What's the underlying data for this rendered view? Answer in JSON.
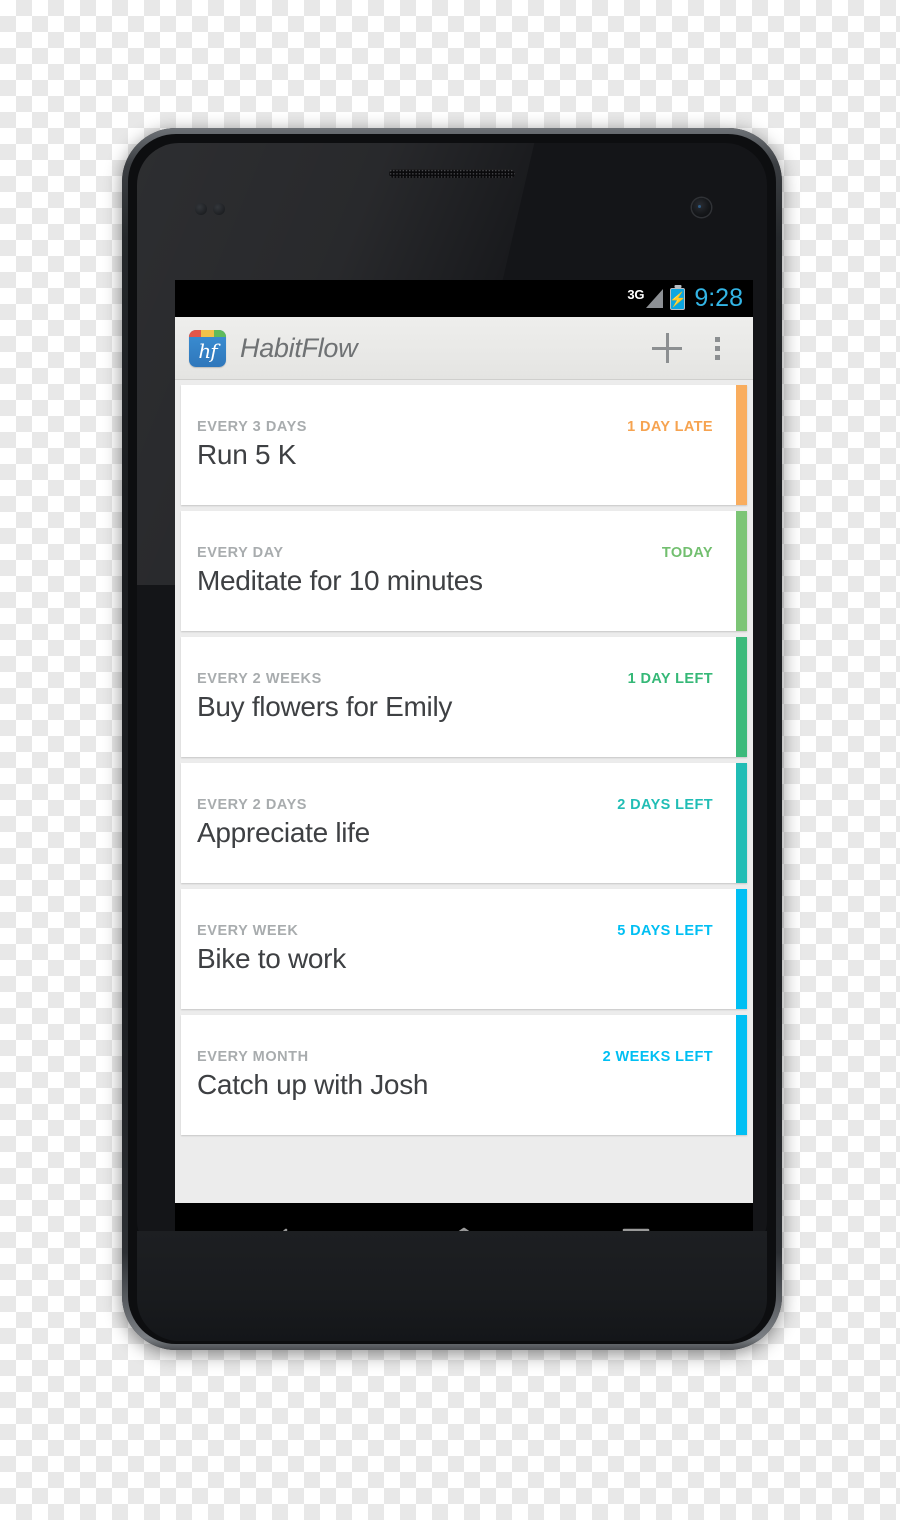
{
  "device": {
    "name": "android-smartphone",
    "earpiece": "earpiece-speaker",
    "camera": "front-camera"
  },
  "status_bar": {
    "network_type": "3G",
    "signal_icon": "signal-bars-icon",
    "battery_icon": "battery-charging-icon",
    "battery_bolt": "⚡",
    "clock": "9:28",
    "clock_color": "#33b5e5",
    "background": "#000000"
  },
  "action_bar": {
    "app_icon": "habitflow-app-icon",
    "app_icon_letters": "hf",
    "title": "HabitFlow",
    "add_label": "+",
    "add_icon": "plus-icon",
    "overflow_icon": "overflow-menu-icon",
    "background": "#e9e9e7",
    "title_color": "#6f7274"
  },
  "habits": [
    {
      "period": "EVERY 3 DAYS",
      "name": "Run 5 K",
      "due": "1 DAY LATE",
      "due_color": "#f6a350",
      "accent_color": "#f9ad5e",
      "status": "late"
    },
    {
      "period": "EVERY DAY",
      "name": "Meditate for 10 minutes",
      "due": "TODAY",
      "due_color": "#72bf6f",
      "accent_color": "#7cc576",
      "status": "today"
    },
    {
      "period": "EVERY 2 WEEKS",
      "name": "Buy flowers for Emily",
      "due": "1 DAY LEFT",
      "due_color": "#35b877",
      "accent_color": "#3cba7b",
      "status": "upcoming"
    },
    {
      "period": "EVERY 2 DAYS",
      "name": "Appreciate life",
      "due": "2 DAYS LEFT",
      "due_color": "#21bdb5",
      "accent_color": "#21bdb5",
      "status": "upcoming"
    },
    {
      "period": "EVERY WEEK",
      "name": "Bike to work",
      "due": "5 DAYS LEFT",
      "due_color": "#00bff3",
      "accent_color": "#00bff3",
      "status": "upcoming"
    },
    {
      "period": "EVERY MONTH",
      "name": "Catch up with Josh",
      "due": "2 WEEKS LEFT",
      "due_color": "#00bff3",
      "accent_color": "#00bff3",
      "status": "upcoming"
    }
  ],
  "nav_bar": {
    "back_icon": "back-arrow-icon",
    "home_icon": "home-icon",
    "recents_icon": "recent-apps-icon",
    "background": "#000000",
    "icon_color": "#9a9a9a"
  }
}
